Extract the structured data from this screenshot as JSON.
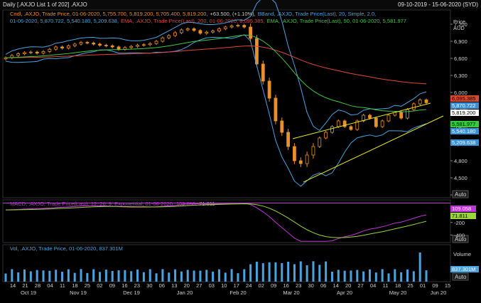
{
  "header": {
    "title": "Daily [.AXJO List 1 of 202] .AXJO",
    "date_range": "09-10-2019 - 15-06-2020 (SYD)"
  },
  "legend": {
    "price_line1_a": "Cndl, .AXJO, Trade Price, 01-06-2020, 5,755.700, 5,819.200, 5,705.400, 5,819.200,",
    "price_line1_b": "+63.500, (+1.10%),",
    "price_line1_c": "BBand, .AXJO, Trade Price(Last), 20, Simple, 2.0,",
    "price_line2_a": "01-06-2020, 5,870.722, 5,540.180, 5,209.638,",
    "price_line2_b": "EMA, .AXJO, Trade Price(Last), 200, 01-06-2020, 6,095.385,",
    "price_line2_c": "EMA, .AXJO, Trade Price(Last), 50, 01-06-2020, 5,581.977",
    "macd_a": "MACD, .AXJO, Trade Price(Last), 12, 26, 9, Exponential, 01-06-2020,",
    "macd_b": "109.058,",
    "macd_c": "71.811",
    "vol": "Vol, .AXJO, Trade Price, 01-06-2020, 837.301M"
  },
  "panels": {
    "price_header_1": "Price",
    "price_header_2": "AUD",
    "volume_header": "Volume",
    "auto_label": "Auto"
  },
  "tags": {
    "ema200": "6,095.385",
    "bb_upper": "5,870.722",
    "close": "5,819.200",
    "ema50": "5,581.977",
    "bb_mid": "5,540.180",
    "bb_lower": "5,209.638",
    "macd": "109.058",
    "signal": "71.811",
    "volume": "837.301M"
  },
  "colors": {
    "up": "#e8902a",
    "down": "#e8902a",
    "bband": "#4aa3df",
    "ema200": "#e0483a",
    "ema50": "#43c643",
    "trend": "#e6e622",
    "macd": "#c035d8",
    "signal": "#9ad63a",
    "volume": "#4aa3df",
    "tag_ema200": "#d9472f",
    "tag_bb": "#3b8fd4",
    "tag_close": "#ffffff",
    "tag_ema50": "#2fcf3a"
  },
  "chart_data": [
    {
      "type": "candlestick",
      "title": "Daily [.AXJO List 1 of 202] .AXJO",
      "ylabel": "Price AUD",
      "yticks": [
        4200,
        4500,
        4800,
        5100,
        5400,
        5700,
        6000,
        6300,
        6600,
        6900,
        7200
      ],
      "ylim": [
        4150,
        7450
      ],
      "x_ticks": [
        "14",
        "21",
        "28",
        "04",
        "11",
        "18",
        "25",
        "02",
        "09",
        "16",
        "23",
        "30",
        "06",
        "13",
        "20",
        "27",
        "03",
        "10",
        "17",
        "24",
        "02",
        "09",
        "16",
        "23",
        "30",
        "06",
        "14",
        "20",
        "27",
        "04",
        "11",
        "18",
        "25",
        "01",
        "09",
        "15"
      ],
      "x_months": [
        "Oct 19",
        "Nov 19",
        "Dec 19",
        "Jan 20",
        "Feb 20",
        "Mar 20",
        "Apr 20",
        "May 20",
        "Jun 20"
      ],
      "close": [
        6610,
        6650,
        6680,
        6700,
        6710,
        6690,
        6720,
        6760,
        6800,
        6780,
        6820,
        6850,
        6880,
        6870,
        6850,
        6830,
        6820,
        6800,
        6760,
        6790,
        6810,
        6830,
        6840,
        6860,
        6900,
        6960,
        7000,
        7050,
        7100,
        7120,
        7090,
        7040,
        7060,
        7080,
        7120,
        7150,
        7170,
        7180,
        7150,
        6950,
        6500,
        6200,
        5900,
        5500,
        5300,
        5050,
        4800,
        4750,
        4900,
        5050,
        5200,
        5300,
        5400,
        5500,
        5400,
        5350,
        5500,
        5600,
        5550,
        5400,
        5500,
        5600,
        5650,
        5550,
        5700,
        5800,
        5870,
        5820
      ],
      "series": [
        {
          "name": "EMA 200",
          "last": 6095.385
        },
        {
          "name": "EMA 50",
          "last": 5581.977
        },
        {
          "name": "BBand Upper",
          "last": 5870.722
        },
        {
          "name": "BBand Mid",
          "last": 5540.18
        },
        {
          "name": "BBand Lower",
          "last": 5209.638
        }
      ],
      "last_close": 5819.2
    },
    {
      "type": "line",
      "title": "MACD, .AXJO, Trade Price(Last), 12, 26, 9, Exponential",
      "yticks": [
        -400,
        -200,
        0
      ],
      "ylim": [
        -520,
        160
      ],
      "series": [
        {
          "name": "MACD",
          "last": 109.058
        },
        {
          "name": "Signal",
          "last": 71.811
        }
      ]
    },
    {
      "type": "bar",
      "title": "Vol, .AXJO, Trade Price",
      "ylabel": "Volume",
      "last": "837.301M"
    }
  ]
}
